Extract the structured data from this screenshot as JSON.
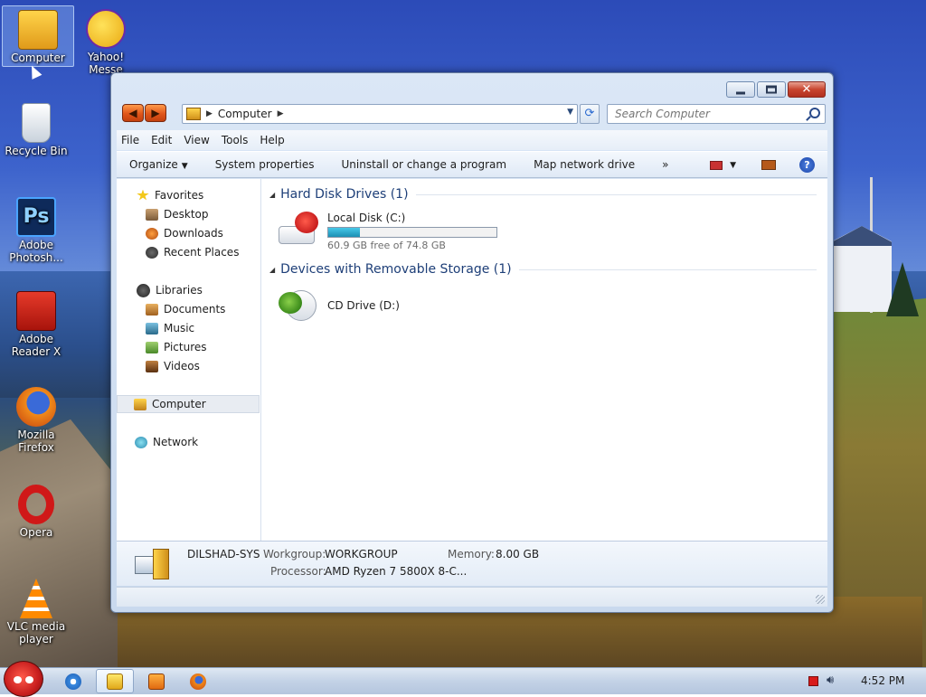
{
  "desktop": {
    "icons": [
      {
        "label": "Computer"
      },
      {
        "label": "Yahoo! Messe"
      },
      {
        "label": "Recycle Bin"
      },
      {
        "label": "Adobe Photosh..."
      },
      {
        "label": "Adobe Reader X"
      },
      {
        "label": "Mozilla Firefox"
      },
      {
        "label": "Opera"
      },
      {
        "label": "VLC media player"
      }
    ]
  },
  "window": {
    "address": {
      "crumb": "Computer"
    },
    "search": {
      "placeholder": "Search Computer"
    },
    "menu": [
      "File",
      "Edit",
      "View",
      "Tools",
      "Help"
    ],
    "commands": {
      "organize": "Organize",
      "system_properties": "System properties",
      "uninstall": "Uninstall or change a program",
      "map_drive": "Map network drive",
      "more": "»"
    },
    "nav": {
      "favorites": "Favorites",
      "desktop": "Desktop",
      "downloads": "Downloads",
      "recent": "Recent Places",
      "libraries": "Libraries",
      "documents": "Documents",
      "music": "Music",
      "pictures": "Pictures",
      "videos": "Videos",
      "computer": "Computer",
      "network": "Network"
    },
    "groups": {
      "hdd": "Hard Disk Drives (1)",
      "removable": "Devices with Removable Storage (1)"
    },
    "drives": {
      "c": {
        "name": "Local Disk (C:)",
        "free": "60.9 GB free of 74.8 GB",
        "used_fraction": 0.186
      },
      "d": {
        "name": "CD Drive (D:)"
      }
    },
    "details": {
      "name": "DILSHAD-SYS",
      "workgroup_label": "Workgroup:",
      "workgroup": "WORKGROUP",
      "memory_label": "Memory:",
      "memory": "8.00 GB",
      "processor_label": "Processor:",
      "processor": "AMD Ryzen 7 5800X 8-C..."
    }
  },
  "taskbar": {
    "clock": "4:52 PM"
  },
  "colors": {
    "accent": "#1e3f78",
    "drive_fill": "#1c8fb4",
    "close_button": "#c8452f",
    "start_orb": "#c81e1e"
  },
  "icons": {
    "computer": "computer-icon",
    "yahoo": "yahoo-messenger-icon",
    "recycle": "recycle-bin-icon",
    "photoshop": "photoshop-icon",
    "reader": "adobe-reader-icon",
    "firefox": "firefox-icon",
    "opera": "opera-icon",
    "vlc": "vlc-icon"
  }
}
